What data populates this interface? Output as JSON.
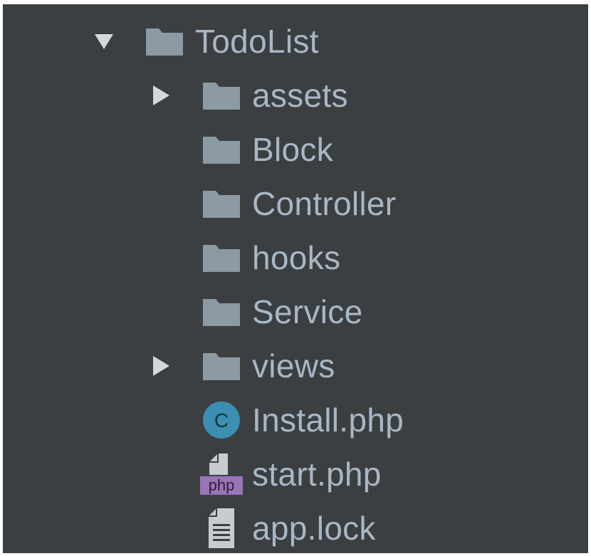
{
  "colors": {
    "panel_bg": "#3c3f41",
    "text": "#a9b7c6",
    "folder_icon": "#8c9aa3",
    "arrow": "#d5d7d9",
    "class_icon_bg": "#3a8fb2",
    "php_badge_bg": "#9a74b7"
  },
  "tree": {
    "root": {
      "label": "TodoList",
      "icon": "folder-icon",
      "expanded": true
    },
    "children": [
      {
        "label": "assets",
        "icon": "folder-icon",
        "collapsed_arrow": true
      },
      {
        "label": "Block",
        "icon": "folder-icon"
      },
      {
        "label": "Controller",
        "icon": "folder-icon"
      },
      {
        "label": "hooks",
        "icon": "folder-icon"
      },
      {
        "label": "Service",
        "icon": "folder-icon"
      },
      {
        "label": "views",
        "icon": "folder-icon",
        "collapsed_arrow": true
      },
      {
        "label": "Install.php",
        "icon": "php-class-icon",
        "badge": "C"
      },
      {
        "label": "start.php",
        "icon": "php-file-icon",
        "badge": "php"
      },
      {
        "label": "app.lock",
        "icon": "text-file-icon"
      }
    ]
  }
}
